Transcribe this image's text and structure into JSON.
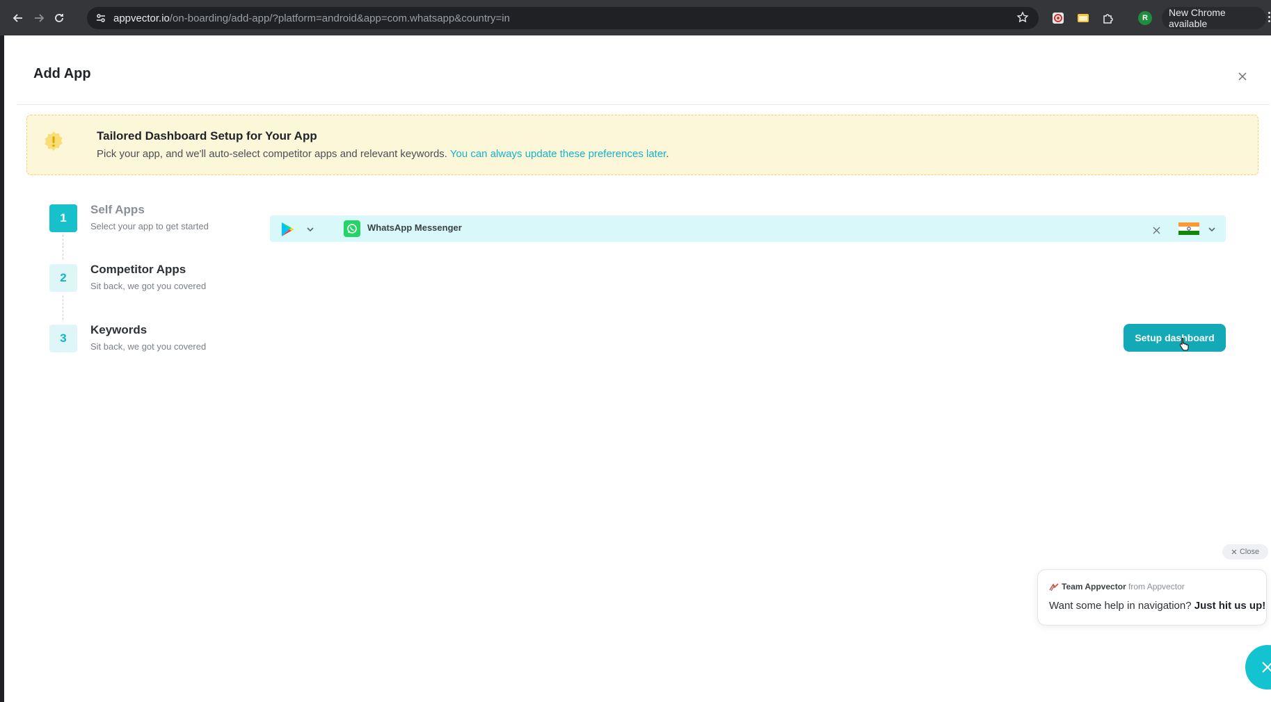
{
  "browser": {
    "url_host": "appvector.io",
    "url_path": "/on-boarding/add-app/?platform=android&app=com.whatsapp&country=in",
    "profile_initial": "R",
    "update_label": "New Chrome available"
  },
  "modal": {
    "title": "Add App"
  },
  "banner": {
    "title": "Tailored Dashboard Setup for Your App",
    "text": "Pick your app, and we'll auto-select competitor apps and relevant keywords. ",
    "link": "You can always update these preferences later",
    "text_end": "."
  },
  "steps": [
    {
      "number": "1",
      "title": "Self Apps",
      "subtitle": "Select your app to get started",
      "active": true
    },
    {
      "number": "2",
      "title": "Competitor Apps",
      "subtitle": "Sit back, we got you covered",
      "active": false
    },
    {
      "number": "3",
      "title": "Keywords",
      "subtitle": "Sit back, we got you covered",
      "active": false
    }
  ],
  "selector": {
    "store_icon": "google-play-icon",
    "app_icon": "whatsapp-icon",
    "app_name": "WhatsApp Messenger",
    "country_flag": "india-flag-icon"
  },
  "actions": {
    "setup_label": "Setup dashboard"
  },
  "chat": {
    "close_label": "Close",
    "sender": "Team Appvector",
    "from_label": " from Appvector",
    "message": "Want some help in navigation? ",
    "message_bold": "Just hit us up!"
  },
  "colors": {
    "accent": "#13b5c6",
    "banner_bg": "#fdf7d9",
    "selector_bg": "#d8f8fa"
  }
}
